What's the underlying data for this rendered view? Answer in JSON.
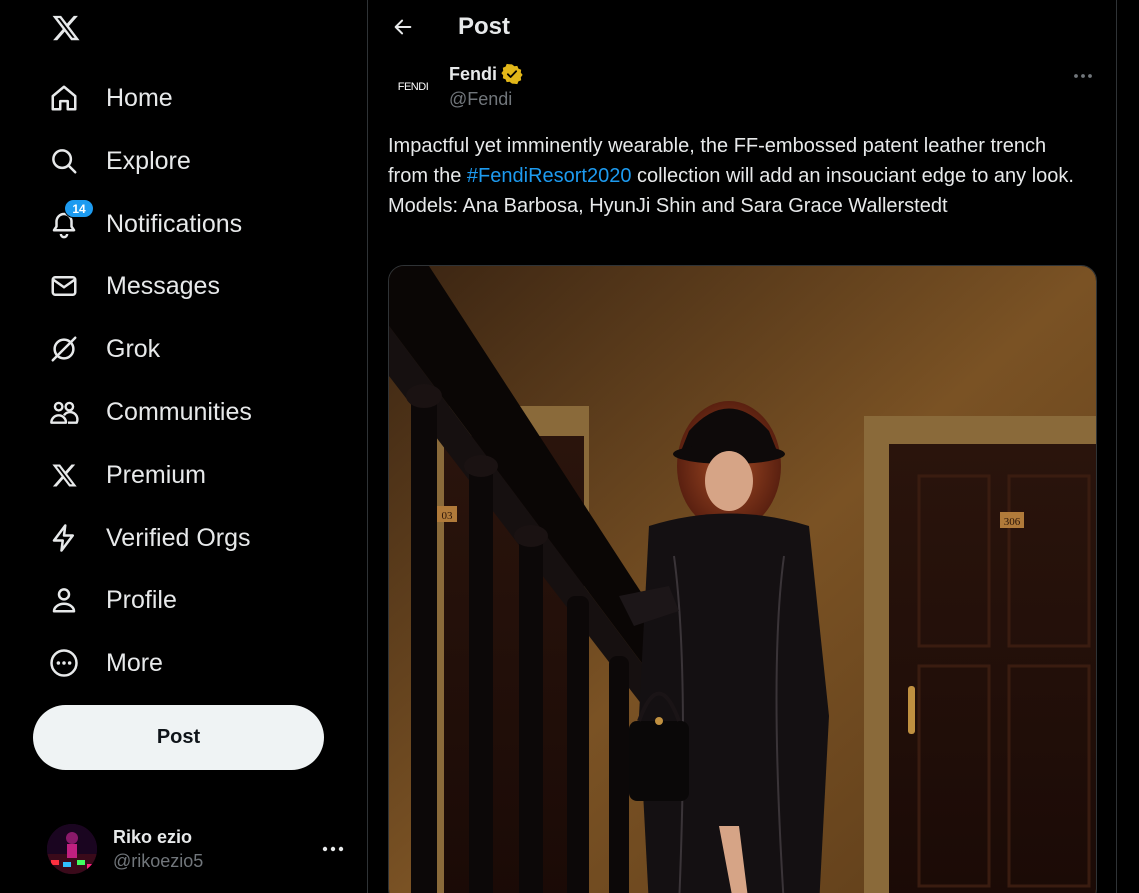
{
  "sidebar": {
    "items": [
      {
        "label": "Home",
        "icon": "home-icon"
      },
      {
        "label": "Explore",
        "icon": "search-icon"
      },
      {
        "label": "Notifications",
        "icon": "bell-icon",
        "badge": "14"
      },
      {
        "label": "Messages",
        "icon": "envelope-icon"
      },
      {
        "label": "Grok",
        "icon": "grok-icon"
      },
      {
        "label": "Communities",
        "icon": "people-icon"
      },
      {
        "label": "Premium",
        "icon": "x-logo-icon"
      },
      {
        "label": "Verified Orgs",
        "icon": "lightning-icon"
      },
      {
        "label": "Profile",
        "icon": "person-icon"
      },
      {
        "label": "More",
        "icon": "more-circle-icon"
      }
    ],
    "post_button": "Post",
    "account": {
      "display_name": "Riko ezio",
      "handle": "@rikoezio5"
    }
  },
  "header": {
    "title": "Post"
  },
  "tweet": {
    "author_name": "Fendi",
    "author_handle": "@Fendi",
    "avatar_text": "FENDI",
    "text_part1": "Impactful yet imminently wearable, the FF-embossed patent leather trench from the ",
    "hashtag": "#FendiResort2020",
    "text_part2": " collection will add an insouciant edge to any look.",
    "text_line2": "Models: Ana Barbosa, HyunJi Shin and Sara Grace Wallerstedt",
    "image": {
      "door_number_left": "03",
      "door_number_right": "306"
    }
  },
  "colors": {
    "background": "#000000",
    "text": "#e7e9ea",
    "muted": "#71767b",
    "accent": "#1d9bf0",
    "verified_gold": "#e2b719",
    "border": "#2f3336"
  }
}
